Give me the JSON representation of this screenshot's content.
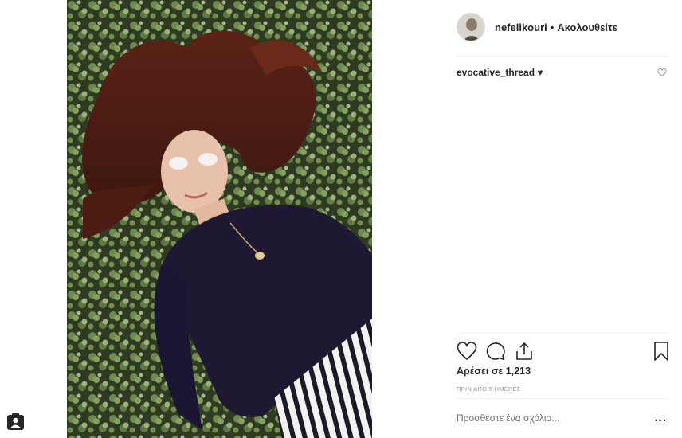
{
  "post": {
    "username": "nefelikouri",
    "separator": "•",
    "follow_state": "Ακολουθείτε",
    "caption_comment": {
      "user": "evocative_thread",
      "text": "♥"
    },
    "likes_text": "Αρέσει σε 1,213",
    "timestamp": "ΠΡΙΝ ΑΠΟ 5 ΗΜΕΡΕΣ",
    "add_comment_placeholder": "Προσθέστε ένα σχόλιο...",
    "more_label": "..."
  },
  "icons": {
    "like": "heart-outline-icon",
    "comment": "speech-bubble-icon",
    "share": "share-upload-icon",
    "save": "bookmark-icon",
    "comment_like": "small-heart-icon",
    "contact": "contact-card-icon"
  },
  "colors": {
    "text": "#262626",
    "muted": "#999999",
    "divider": "#efefef"
  }
}
